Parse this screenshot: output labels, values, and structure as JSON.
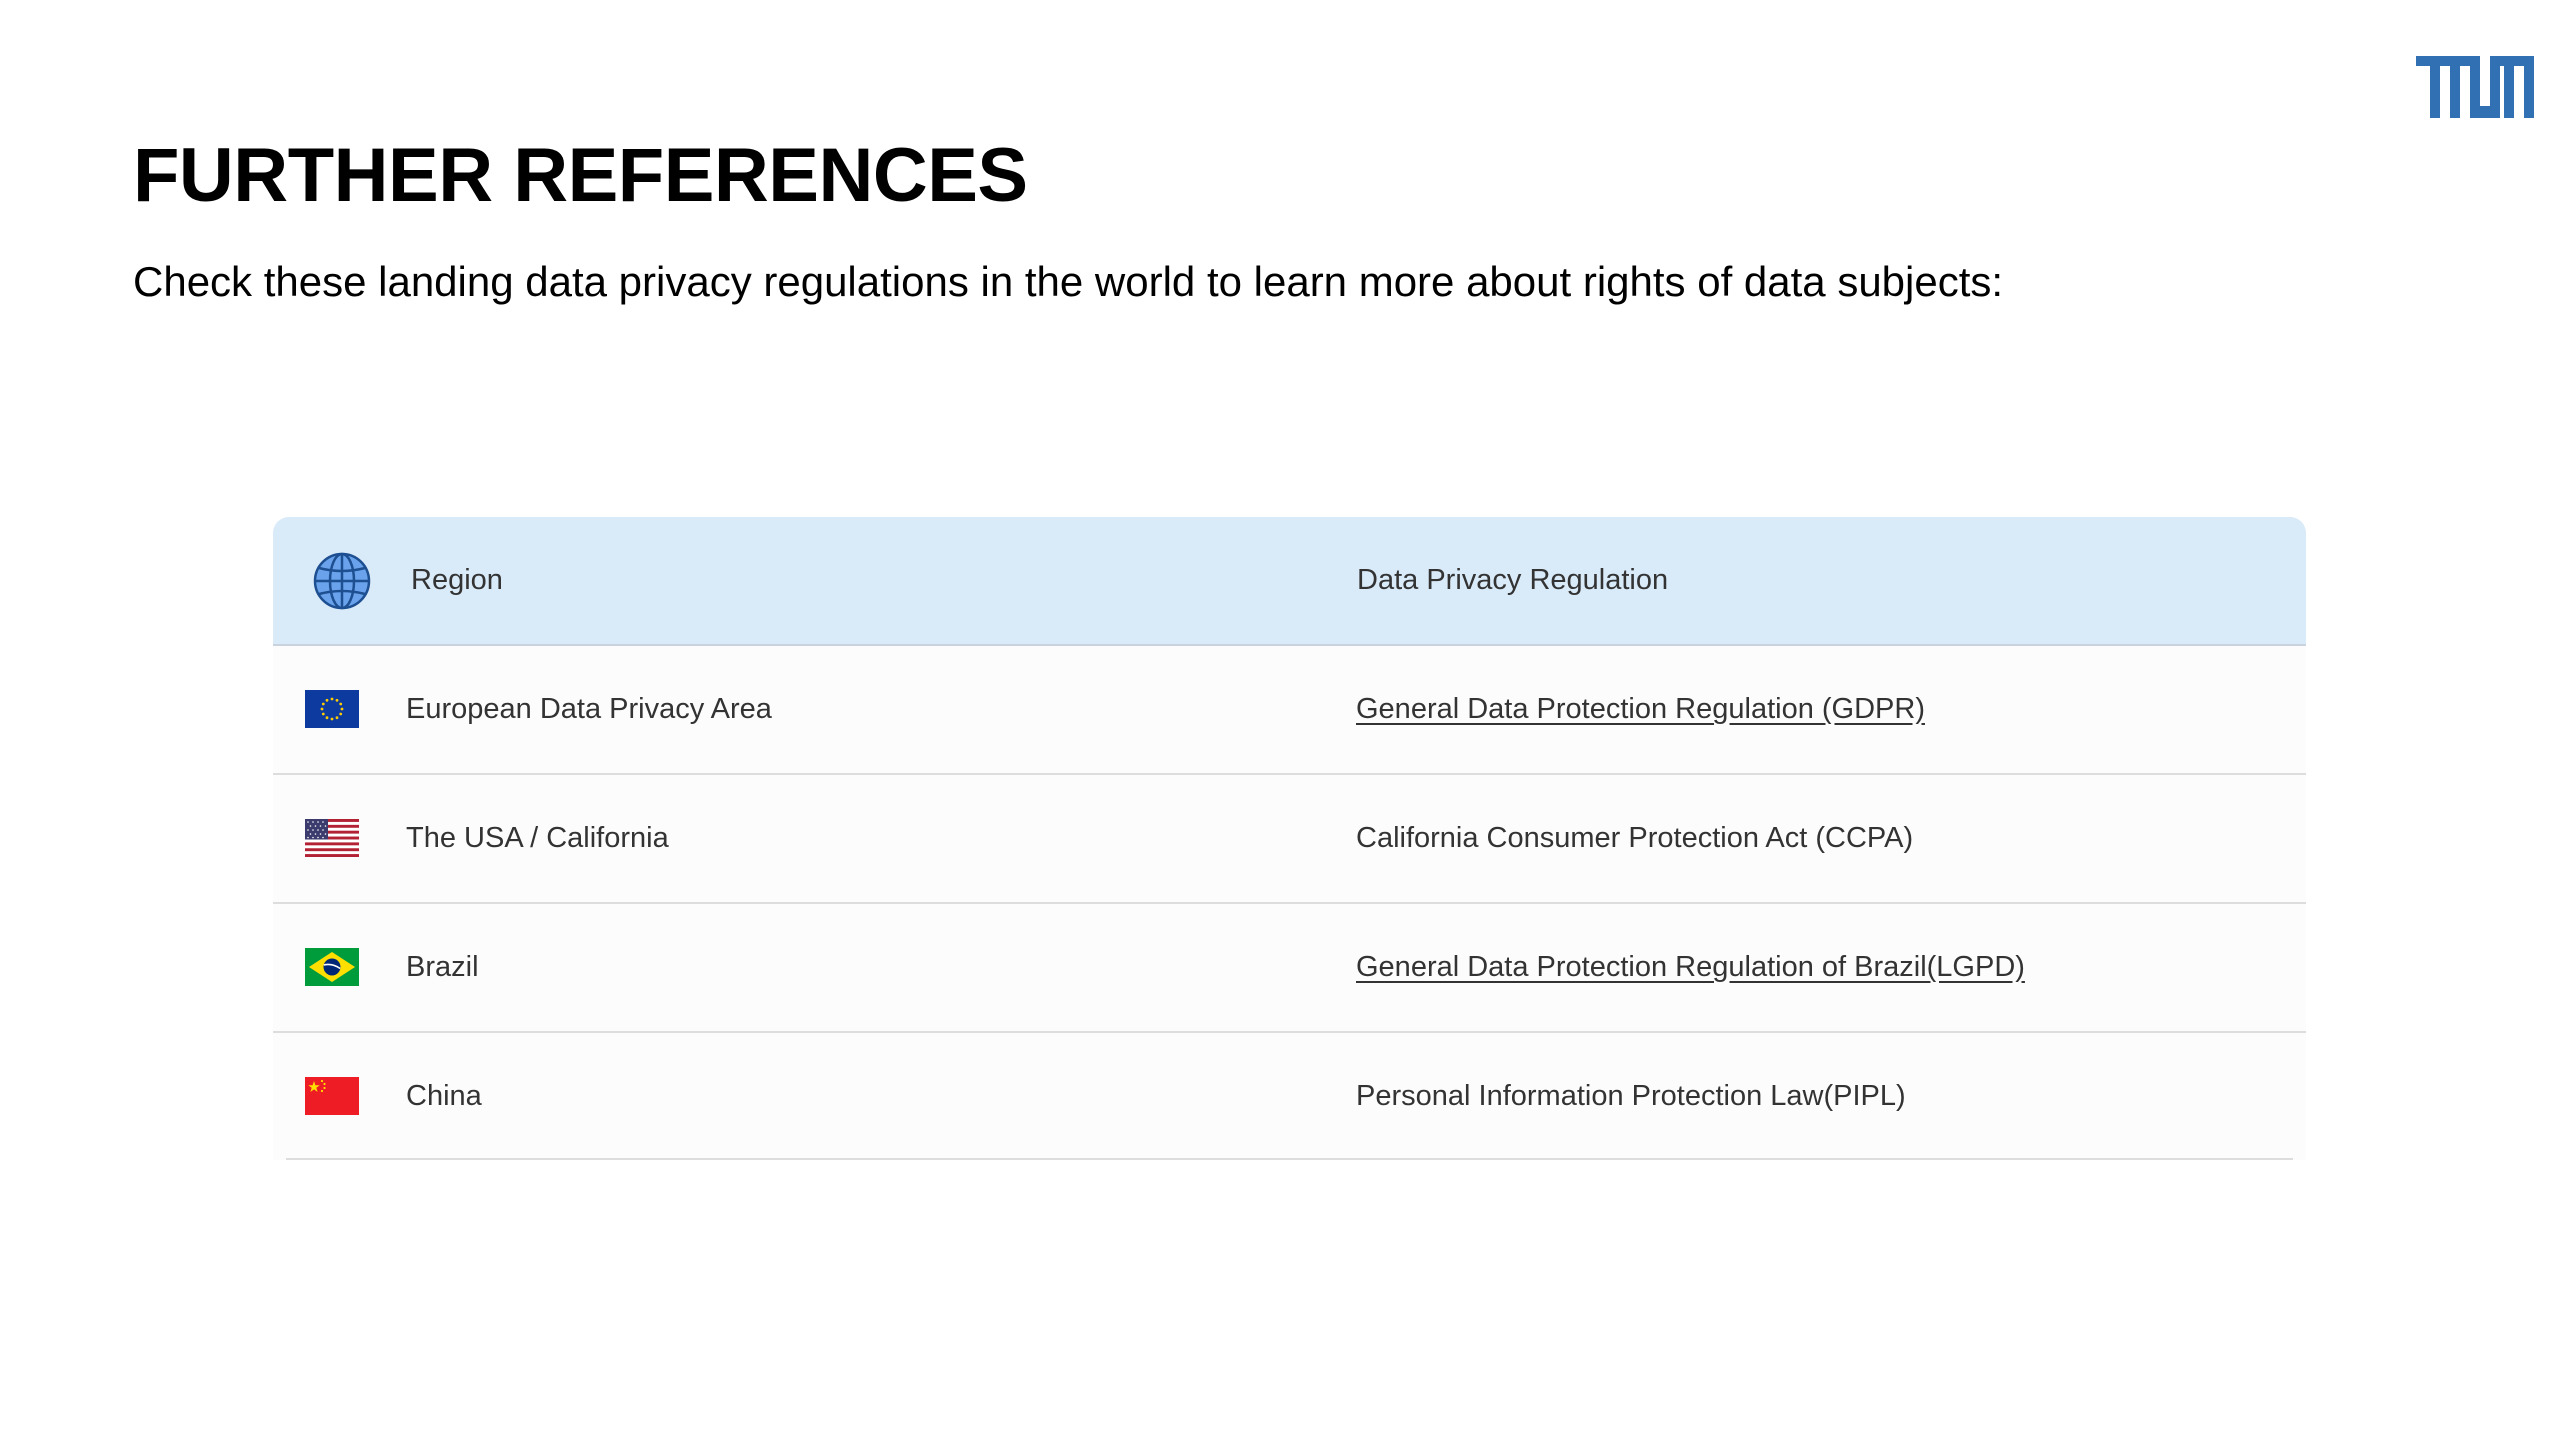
{
  "slide": {
    "title": "FURTHER REFERENCES",
    "subtitle": "Check these landing data privacy regulations in the world to learn more about rights of data subjects:",
    "logo_icon": "tum-logo",
    "brand_color": "#3070b3"
  },
  "table": {
    "header": {
      "icon": "globe-icon",
      "region_label": "Region",
      "regulation_label": "Data Privacy Regulation",
      "header_bg": "#d9eaf9"
    },
    "rows": [
      {
        "flag": "eu-flag-icon",
        "region": "European Data Privacy Area",
        "regulation": "General Data Protection Regulation (GDPR)",
        "is_link": true
      },
      {
        "flag": "usa-flag-icon",
        "region": "The USA / California",
        "regulation": "California Consumer Protection Act (CCPA)",
        "is_link": false
      },
      {
        "flag": "brazil-flag-icon",
        "region": "Brazil",
        "regulation": "General Data Protection Regulation of Brazil(LGPD)",
        "is_link": true
      },
      {
        "flag": "china-flag-icon",
        "region": "China",
        "regulation": "Personal Information Protection Law(PIPL)",
        "is_link": false
      }
    ]
  }
}
